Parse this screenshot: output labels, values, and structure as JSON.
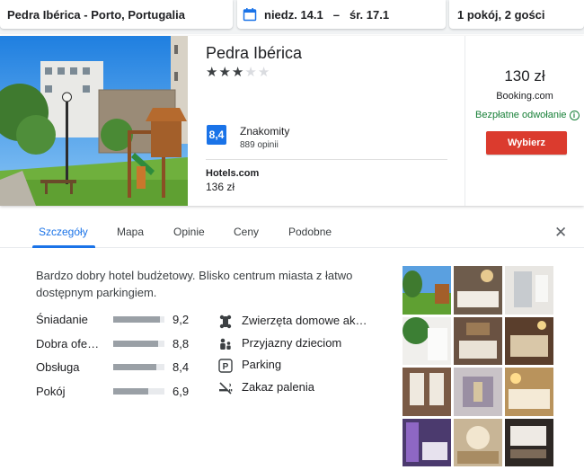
{
  "search": {
    "location": "Pedra Ibérica - Porto, Portugalia",
    "checkin": "niedz. 14.1",
    "separator": "–",
    "checkout": "śr. 17.1",
    "guests": "1 pokój, 2 gości"
  },
  "hotel": {
    "name": "Pedra Ibérica",
    "stars": 3,
    "max_stars": 5,
    "score": "8,4",
    "score_label": "Znakomity",
    "reviews": "889 opinii",
    "provider": "Hotels.com",
    "provider_price": "136 zł",
    "main_price": "130 zł",
    "main_provider": "Booking.com",
    "cancellation": "Bezpłatne odwołanie",
    "select_button": "Wybierz"
  },
  "tabs": [
    {
      "label": "Szczegóły",
      "active": true
    },
    {
      "label": "Mapa",
      "active": false
    },
    {
      "label": "Opinie",
      "active": false
    },
    {
      "label": "Ceny",
      "active": false
    },
    {
      "label": "Podobne",
      "active": false
    }
  ],
  "details": {
    "description": "Bardzo dobry hotel budżetowy. Blisko centrum miasta z łatwo dostępnym parkingiem.",
    "ratings": [
      {
        "label": "Śniadanie",
        "value": "9,2",
        "fraction": 0.92
      },
      {
        "label": "Dobra ofe…",
        "value": "8,8",
        "fraction": 0.88
      },
      {
        "label": "Obsługa",
        "value": "8,4",
        "fraction": 0.84
      },
      {
        "label": "Pokój",
        "value": "6,9",
        "fraction": 0.69
      }
    ],
    "amenities": [
      {
        "label": "Zwierzęta domowe ak…",
        "icon": "pet-icon"
      },
      {
        "label": "Przyjazny dzieciom",
        "icon": "family-icon"
      },
      {
        "label": "Parking",
        "icon": "parking-icon"
      },
      {
        "label": "Zakaz palenia",
        "icon": "no-smoking-icon"
      }
    ]
  },
  "colors": {
    "accent": "#1a73e8",
    "button": "#db3b2e",
    "free_cancel": "#188038"
  }
}
